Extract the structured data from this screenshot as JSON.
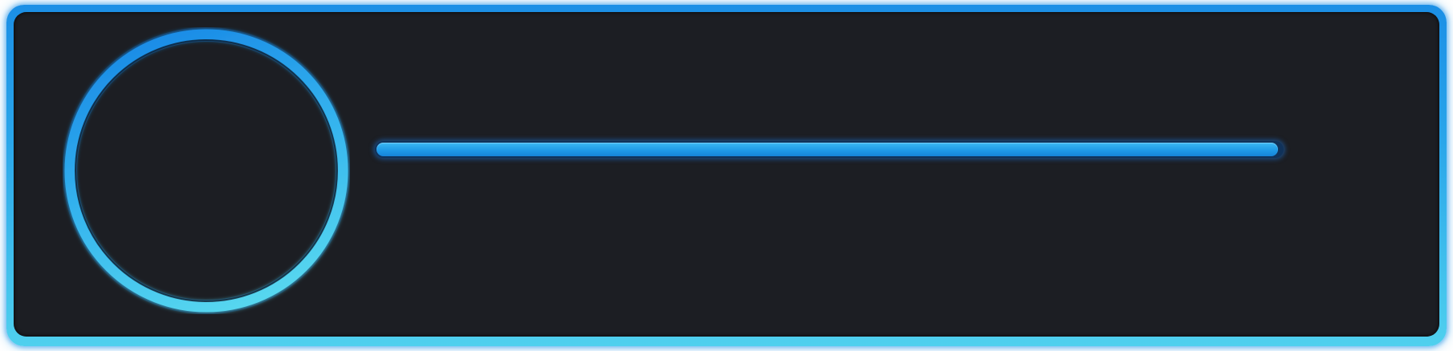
{
  "colors": {
    "frame_top": "#1b8fe6",
    "frame_bottom": "#4fd0ee",
    "panel_background": "#1c1e23",
    "ring_start": "#1a8ae6",
    "ring_end": "#56d6ef",
    "bar_fill": "#1f9ae8",
    "bar_track": "#10325a"
  },
  "progress": {
    "fraction": 0.996
  }
}
